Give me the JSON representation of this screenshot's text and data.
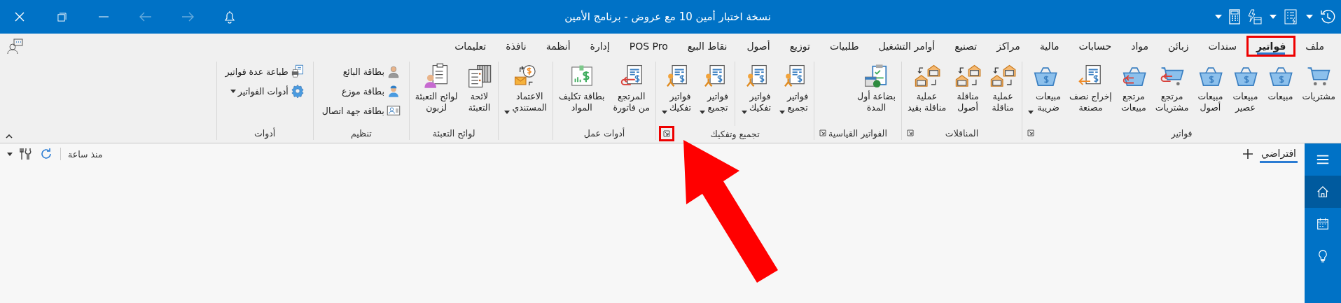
{
  "titlebar": {
    "title": "نسخة اختبار أمين 10 مع عروض - برنامج الأمين",
    "back": {
      "disabled": true
    },
    "forward": {
      "disabled": true
    }
  },
  "tabs": [
    {
      "label": "ملف",
      "selected": false,
      "highlighted": false
    },
    {
      "label": "فواتير",
      "selected": true,
      "highlighted": true
    },
    {
      "label": "سندات",
      "selected": false,
      "highlighted": false
    },
    {
      "label": "زبائن",
      "selected": false,
      "highlighted": false
    },
    {
      "label": "مواد",
      "selected": false,
      "highlighted": false
    },
    {
      "label": "حسابات",
      "selected": false,
      "highlighted": false
    },
    {
      "label": "مالية",
      "selected": false,
      "highlighted": false
    },
    {
      "label": "مراكز",
      "selected": false,
      "highlighted": false
    },
    {
      "label": "تصنيع",
      "selected": false,
      "highlighted": false
    },
    {
      "label": "أوامر التشغيل",
      "selected": false,
      "highlighted": false
    },
    {
      "label": "طلبيات",
      "selected": false,
      "highlighted": false
    },
    {
      "label": "توزيع",
      "selected": false,
      "highlighted": false
    },
    {
      "label": "أصول",
      "selected": false,
      "highlighted": false
    },
    {
      "label": "نقاط البيع",
      "selected": false,
      "highlighted": false
    },
    {
      "label": "POS Pro",
      "selected": false,
      "highlighted": false
    },
    {
      "label": "إدارة",
      "selected": false,
      "highlighted": false
    },
    {
      "label": "أنظمة",
      "selected": false,
      "highlighted": false
    },
    {
      "label": "نافذة",
      "selected": false,
      "highlighted": false
    },
    {
      "label": "تعليمات",
      "selected": false,
      "highlighted": false
    }
  ],
  "ribbon": {
    "groups": [
      {
        "label": "فواتير",
        "kind": "large",
        "launcher": true,
        "buttons": [
          {
            "lines": [
              "مشتريات"
            ]
          },
          {
            "lines": [
              "مبيعات"
            ]
          },
          {
            "lines": [
              "مبيعات",
              "عصير"
            ]
          },
          {
            "lines": [
              "مبيعات",
              "أصول"
            ]
          },
          {
            "lines": [
              "مرتجع",
              "مشتريات"
            ]
          },
          {
            "lines": [
              "مرتجع",
              "مبيعات"
            ]
          },
          {
            "lines": [
              "إخراج نصف",
              "مصنعة"
            ]
          },
          {
            "lines": [
              "مبيعات",
              "ضريبة"
            ],
            "dropdown": true
          }
        ]
      },
      {
        "label": "المناقلات",
        "kind": "large",
        "launcher": true,
        "buttons": [
          {
            "lines": [
              "عملية",
              "مناقلة"
            ]
          },
          {
            "lines": [
              "مناقلة",
              "أصول"
            ]
          },
          {
            "lines": [
              "عملية",
              "مناقلة بقيد"
            ]
          }
        ]
      },
      {
        "label": "الفواتير القياسية",
        "kind": "large",
        "launcher": true,
        "buttons": [
          {
            "lines": [
              "بضاعة أول",
              "المدة"
            ]
          }
        ]
      },
      {
        "label": "تجميع وتفكيك",
        "kind": "large",
        "launcher": true,
        "launcher_highlighted": true,
        "buttons": [
          {
            "lines": [
              "فواتير",
              "تجميع"
            ],
            "dropdown": true
          },
          {
            "lines": [
              "فواتير",
              "تفكيك"
            ],
            "dropdown": true
          },
          {
            "lines": [
              "فواتير",
              "تجميع"
            ],
            "dropdown": true,
            "separated": true
          },
          {
            "lines": [
              "فواتير",
              "تفكيك"
            ],
            "dropdown": true
          }
        ]
      },
      {
        "label": "أدوات عمل",
        "kind": "large",
        "buttons": [
          {
            "lines": [
              "المرتجع",
              "من فاتورة"
            ]
          },
          {
            "lines": [
              "بطاقة تكليف",
              "المواد"
            ]
          }
        ]
      },
      {
        "kind": "large",
        "buttons": [
          {
            "lines": [
              "الاعتماد",
              "المستندي"
            ],
            "dropdown": true
          }
        ]
      },
      {
        "label": "لوائح التعبئة",
        "kind": "large",
        "buttons": [
          {
            "lines": [
              "لائحة",
              "التعبئة"
            ]
          },
          {
            "lines": [
              "لوائح التعبئة",
              "لزبون"
            ]
          }
        ]
      },
      {
        "label": "تنظيم",
        "kind": "small",
        "buttons": [
          {
            "lines": [
              "بطاقة البائع"
            ]
          },
          {
            "lines": [
              "بطاقة موزع"
            ]
          },
          {
            "lines": [
              "بطاقة جهة اتصال"
            ]
          }
        ]
      },
      {
        "label": "أدوات",
        "kind": "small",
        "buttons": [
          {
            "lines": [
              "طباعة عدة فواتير"
            ]
          },
          {
            "lines": [
              "أدوات الفواتير"
            ],
            "dropdown": true
          }
        ]
      }
    ]
  },
  "workspace": {
    "tabs": [
      {
        "label": "افتراضي",
        "selected": true
      }
    ],
    "updated": "منذ ساعة"
  },
  "sidebar": {
    "items": [
      {
        "selected": false
      },
      {
        "selected": true
      },
      {
        "selected": false
      },
      {
        "selected": false
      }
    ]
  }
}
